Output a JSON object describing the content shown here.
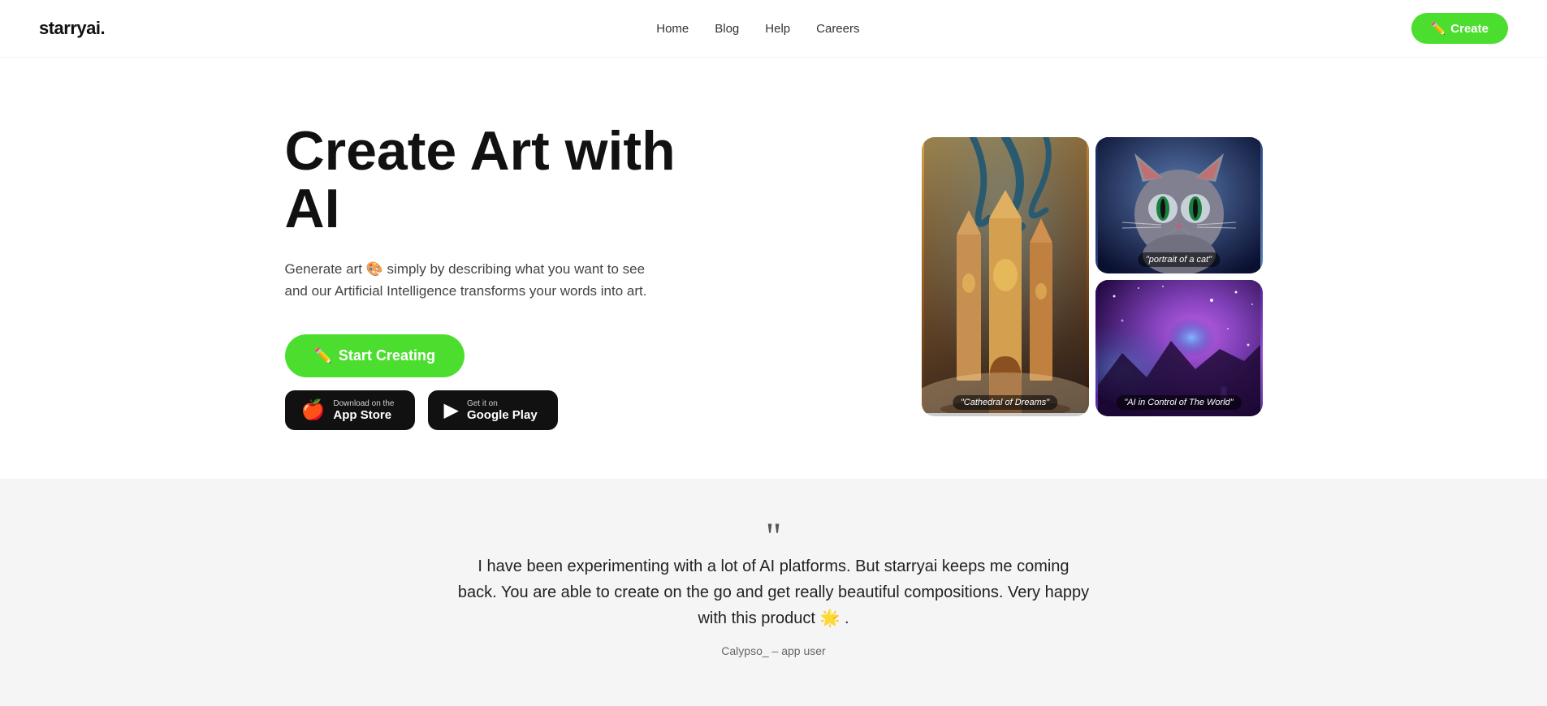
{
  "nav": {
    "logo": "starryai.",
    "links": [
      {
        "label": "Home",
        "href": "#"
      },
      {
        "label": "Blog",
        "href": "#"
      },
      {
        "label": "Help",
        "href": "#"
      },
      {
        "label": "Careers",
        "href": "#"
      }
    ],
    "create_button": "Create"
  },
  "hero": {
    "title": "Create Art with AI",
    "description_part1": "Generate art 🎨 simply by describing what you want to see",
    "description_part2": "and our Artificial Intelligence transforms your words into art.",
    "start_button": "Start Creating",
    "app_store": {
      "small_text": "Download on the",
      "big_text": "App Store"
    },
    "google_play": {
      "small_text": "Get it on",
      "big_text": "Google Play"
    }
  },
  "images": [
    {
      "id": "cathedral",
      "label": "\"Cathedral of Dreams\"",
      "type": "tall"
    },
    {
      "id": "cat",
      "label": "\"portrait of a cat\"",
      "type": "normal"
    },
    {
      "id": "space",
      "label": "\"AI in Control of The World\"",
      "type": "normal"
    }
  ],
  "testimonial": {
    "quote": "I have been experimenting with a lot of AI platforms. But starryai keeps me coming back. You are able to create on the go and get really beautiful compositions. Very happy with this product 🌟 .",
    "author": "Calypso_ – app user"
  }
}
